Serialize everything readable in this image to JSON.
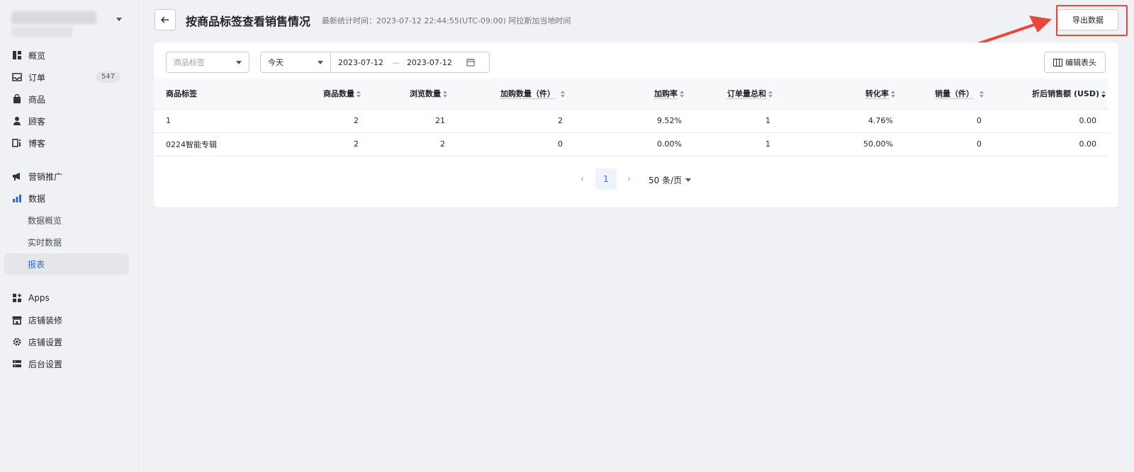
{
  "sidebar": {
    "nav": [
      {
        "label": "概览",
        "icon": "dashboard-icon"
      },
      {
        "label": "订单",
        "icon": "inbox-icon",
        "badge": "547"
      },
      {
        "label": "商品",
        "icon": "bag-icon"
      },
      {
        "label": "顾客",
        "icon": "person-icon"
      },
      {
        "label": "博客",
        "icon": "blog-icon"
      },
      {
        "label": "营销推广",
        "icon": "megaphone-icon"
      },
      {
        "label": "数据",
        "icon": "bar-chart-icon"
      },
      {
        "label": "数据概览"
      },
      {
        "label": "实时数据"
      },
      {
        "label": "报表"
      },
      {
        "label": "Apps",
        "icon": "apps-icon"
      },
      {
        "label": "店铺装修",
        "icon": "storefront-icon"
      },
      {
        "label": "店铺设置",
        "icon": "gear-icon"
      },
      {
        "label": "后台设置",
        "icon": "server-icon"
      }
    ],
    "active_item": "报表"
  },
  "header": {
    "title": "按商品标签查看销售情况",
    "subtitle": "最新统计时间：2023-07-12 22:44:55(UTC-09:00) 阿拉斯加当地时间",
    "export_label": "导出数据"
  },
  "filters": {
    "tag_placeholder": "商品标签",
    "period": "今天",
    "date_start": "2023-07-12",
    "date_sep": "—",
    "date_end": "2023-07-12",
    "edit_columns_label": "编辑表头"
  },
  "table": {
    "headers": [
      "商品标签",
      "商品数量",
      "浏览数量",
      "加购数量（件）",
      "加购率",
      "订单量总和",
      "转化率",
      "销量（件）",
      "折后销售额 (USD)"
    ],
    "rows": [
      [
        "1",
        "2",
        "21",
        "2",
        "9.52%",
        "1",
        "4.76%",
        "0",
        "0.00"
      ],
      [
        "0224智能专辑",
        "2",
        "2",
        "0",
        "0.00%",
        "1",
        "50.00%",
        "0",
        "0.00"
      ]
    ]
  },
  "pagination": {
    "current_page": "1",
    "page_size": "50 条/页"
  },
  "colors": {
    "accent": "#2d6cdf",
    "highlight": "#e8483b",
    "background": "#f0f1f4"
  }
}
